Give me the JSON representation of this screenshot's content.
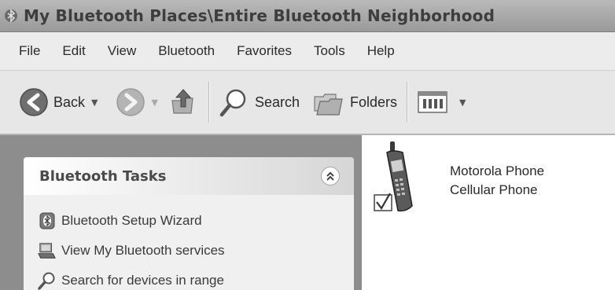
{
  "window": {
    "title": "My Bluetooth Places\\Entire Bluetooth Neighborhood"
  },
  "menu": {
    "items": [
      "File",
      "Edit",
      "View",
      "Bluetooth",
      "Favorites",
      "Tools",
      "Help"
    ]
  },
  "toolbar": {
    "back_label": "Back",
    "search_label": "Search",
    "folders_label": "Folders",
    "icons": {
      "back": "back-arrow-icon",
      "forward": "forward-arrow-icon",
      "up": "up-folder-icon",
      "search": "magnifier-icon",
      "folders": "folders-icon",
      "views": "views-icon"
    }
  },
  "task_panel": {
    "title": "Bluetooth Tasks",
    "items": [
      {
        "label": "Bluetooth Setup Wizard",
        "icon": "bluetooth-wizard-icon"
      },
      {
        "label": "View My Bluetooth services",
        "icon": "computer-services-icon"
      },
      {
        "label": "Search for devices in range",
        "icon": "search-icon"
      }
    ]
  },
  "device": {
    "name": "Motorola Phone",
    "type": "Cellular Phone",
    "icon": "cellular-phone-icon",
    "checked": true
  }
}
